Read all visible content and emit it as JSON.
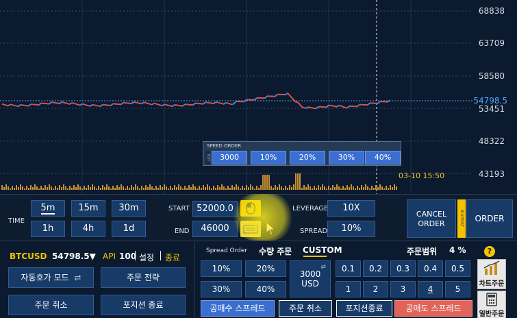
{
  "chart": {
    "y_labels": [
      "68838",
      "63709",
      "58580",
      "53451",
      "48322",
      "43193"
    ],
    "last_price": "54798.5",
    "time_tag": "03-10 15:50",
    "speed_order": {
      "caption": "SPEED ORDER",
      "side": "BUY",
      "buttons": [
        "3000",
        "10%",
        "20%",
        "30%",
        "40%"
      ]
    }
  },
  "controls": {
    "time_label": "TIME",
    "time_buttons": [
      "5m",
      "15m",
      "30m",
      "1h",
      "4h",
      "1d"
    ],
    "selected_time": "5m",
    "start_label": "START",
    "start_value": "52000.0",
    "end_label": "END",
    "end_value": "46000",
    "leverage_label": "LEVERAGE",
    "leverage_value": "10X",
    "spread_label": "SPREAD",
    "spread_value": "10%",
    "cancel_order": "CANCEL ORDER",
    "side_tag": "BUY/POST",
    "order": "ORDER"
  },
  "left_panel": {
    "symbol": "BTCUSD",
    "price": "54798.5▼",
    "api_label": "API",
    "api_value": "100",
    "settings": "설정",
    "exit": "종료",
    "btn_auto_mode": "자동호가 모드",
    "btn_strategy": "주문 전략",
    "btn_cancel": "주문 취소",
    "btn_close_position": "포지션 종료"
  },
  "right_panel": {
    "spread_order": "Spread Order",
    "qty_title": "수량 주문",
    "custom": "CUSTOM",
    "range_label": "주문범위",
    "range_value": "4 %",
    "pct_buttons": [
      "10%",
      "20%",
      "30%",
      "40%"
    ],
    "usd_value": "3000",
    "usd_unit": "USD",
    "range_top": [
      "0.1",
      "0.2",
      "0.3",
      "0.4",
      "0.5"
    ],
    "range_bottom": [
      "1",
      "2",
      "3",
      "4",
      "5"
    ],
    "btn_buy_spread": "공매수 스프레드",
    "btn_cancel": "주문 취소",
    "btn_close": "포지션종료",
    "btn_sell_spread": "공매도 스프레드",
    "chart_order": "차트주문",
    "normal_order": "일반주문",
    "help": "?"
  },
  "colors": {
    "background": "#0b1a2e",
    "button": "#173a67",
    "speed_button": "#3a6fd0",
    "accent_yellow": "#f5c400",
    "price_line": "#4fa8ff",
    "sell_red": "#e0645a"
  }
}
